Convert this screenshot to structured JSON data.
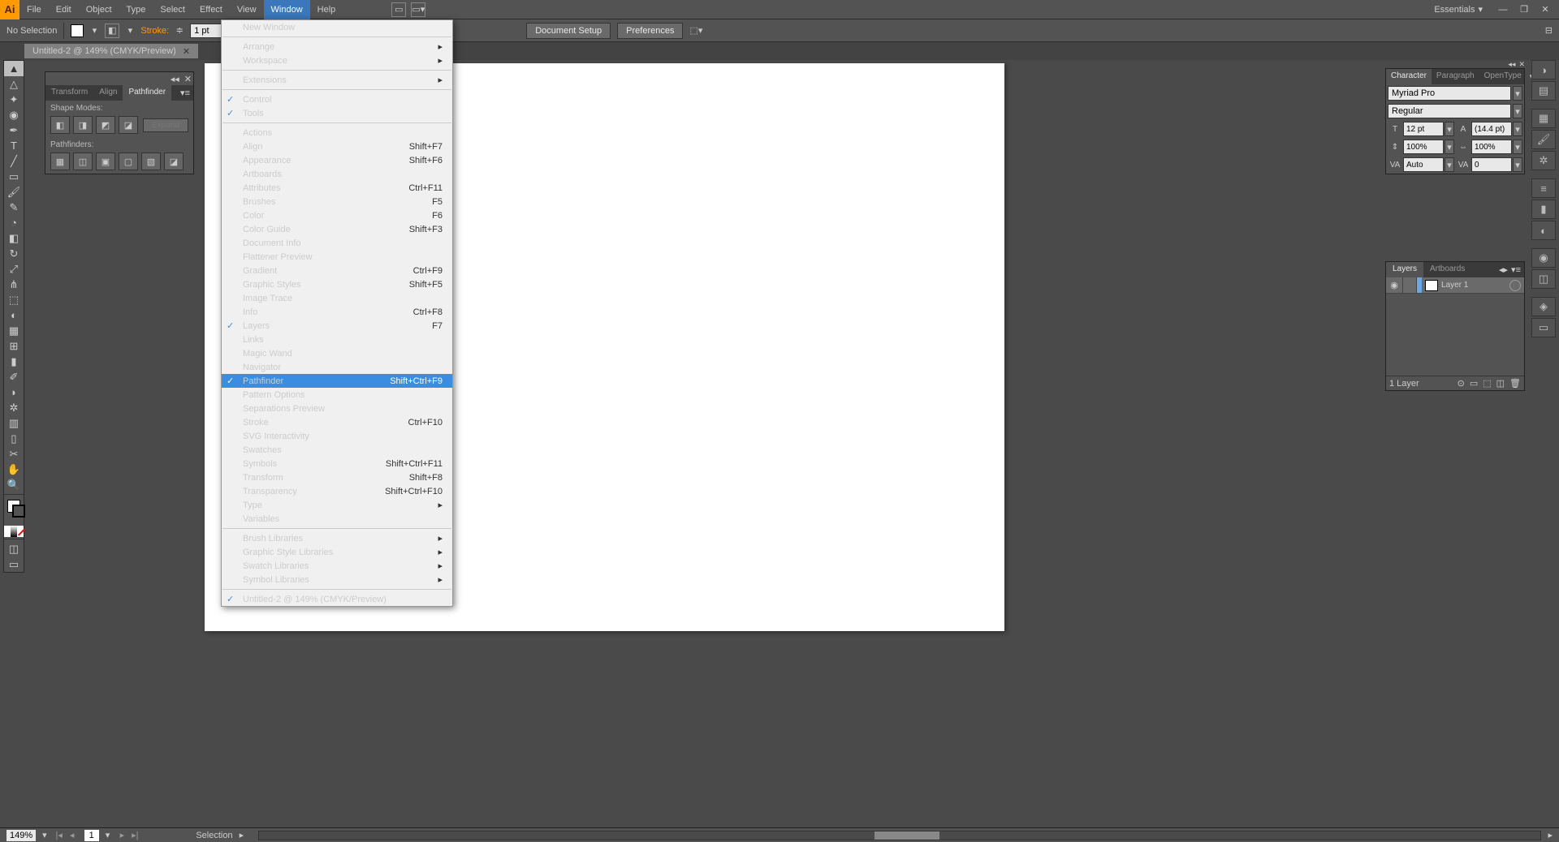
{
  "menubar": {
    "items": [
      "File",
      "Edit",
      "Object",
      "Type",
      "Select",
      "Effect",
      "View",
      "Window",
      "Help"
    ],
    "active": "Window",
    "workspace": "Essentials"
  },
  "controlbar": {
    "selection": "No Selection",
    "stroke_label": "Stroke:",
    "stroke_val": "1 pt",
    "doc_setup": "Document Setup",
    "preferences": "Preferences"
  },
  "doc_tab": {
    "title": "Untitled-2 @ 149% (CMYK/Preview)"
  },
  "window_menu": [
    {
      "label": "New Window"
    },
    {
      "sep": true
    },
    {
      "label": "Arrange",
      "submenu": true
    },
    {
      "label": "Workspace",
      "submenu": true
    },
    {
      "sep": true
    },
    {
      "label": "Extensions",
      "submenu": true
    },
    {
      "sep": true
    },
    {
      "label": "Control",
      "checked": true
    },
    {
      "label": "Tools",
      "checked": true
    },
    {
      "sep": true
    },
    {
      "label": "Actions"
    },
    {
      "label": "Align",
      "shortcut": "Shift+F7"
    },
    {
      "label": "Appearance",
      "shortcut": "Shift+F6"
    },
    {
      "label": "Artboards"
    },
    {
      "label": "Attributes",
      "shortcut": "Ctrl+F11"
    },
    {
      "label": "Brushes",
      "shortcut": "F5"
    },
    {
      "label": "Color",
      "shortcut": "F6"
    },
    {
      "label": "Color Guide",
      "shortcut": "Shift+F3"
    },
    {
      "label": "Document Info"
    },
    {
      "label": "Flattener Preview"
    },
    {
      "label": "Gradient",
      "shortcut": "Ctrl+F9"
    },
    {
      "label": "Graphic Styles",
      "shortcut": "Shift+F5"
    },
    {
      "label": "Image Trace"
    },
    {
      "label": "Info",
      "shortcut": "Ctrl+F8"
    },
    {
      "label": "Layers",
      "shortcut": "F7",
      "checked": true
    },
    {
      "label": "Links"
    },
    {
      "label": "Magic Wand"
    },
    {
      "label": "Navigator"
    },
    {
      "label": "Pathfinder",
      "shortcut": "Shift+Ctrl+F9",
      "checked": true,
      "hover": true
    },
    {
      "label": "Pattern Options"
    },
    {
      "label": "Separations Preview"
    },
    {
      "label": "Stroke",
      "shortcut": "Ctrl+F10"
    },
    {
      "label": "SVG Interactivity"
    },
    {
      "label": "Swatches"
    },
    {
      "label": "Symbols",
      "shortcut": "Shift+Ctrl+F11"
    },
    {
      "label": "Transform",
      "shortcut": "Shift+F8"
    },
    {
      "label": "Transparency",
      "shortcut": "Shift+Ctrl+F10"
    },
    {
      "label": "Type",
      "submenu": true
    },
    {
      "label": "Variables"
    },
    {
      "sep": true
    },
    {
      "label": "Brush Libraries",
      "submenu": true
    },
    {
      "label": "Graphic Style Libraries",
      "submenu": true
    },
    {
      "label": "Swatch Libraries",
      "submenu": true
    },
    {
      "label": "Symbol Libraries",
      "submenu": true
    },
    {
      "sep": true
    },
    {
      "label": "Untitled-2 @ 149% (CMYK/Preview)",
      "checked": true
    }
  ],
  "pathfinder": {
    "tabs": [
      "Transform",
      "Align",
      "Pathfinder"
    ],
    "active": "Pathfinder",
    "shape_modes": "Shape Modes:",
    "pathfinders": "Pathfinders:",
    "expand": "Expand"
  },
  "character": {
    "tabs": [
      "Character",
      "Paragraph",
      "OpenType"
    ],
    "active": "Character",
    "font": "Myriad Pro",
    "style": "Regular",
    "size": "12 pt",
    "leading": "(14.4 pt)",
    "tracking": "100%",
    "kerning": "100%",
    "va": "Auto",
    "baseline": "0"
  },
  "layers": {
    "tabs": [
      "Layers",
      "Artboards"
    ],
    "active": "Layers",
    "layer_name": "Layer 1",
    "count": "1 Layer"
  },
  "statusbar": {
    "zoom": "149%",
    "page": "1",
    "tool": "Selection"
  }
}
